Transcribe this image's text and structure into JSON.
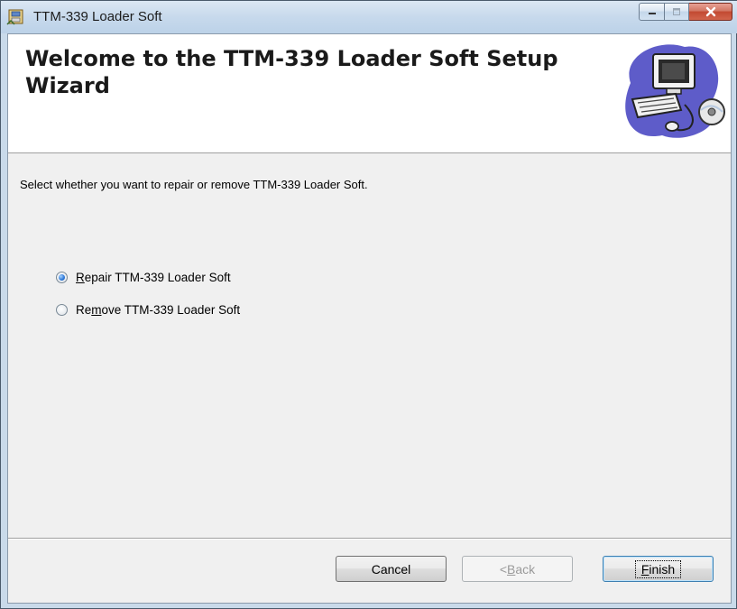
{
  "window": {
    "title": "TTM-339 Loader Soft",
    "icon": "installer-icon",
    "caption_buttons": [
      "minimize-icon",
      "maximize-icon",
      "close-icon"
    ]
  },
  "banner": {
    "title": "Welcome to the TTM-339 Loader Soft Setup Wizard",
    "art": "computer-setup-icon"
  },
  "body": {
    "description": "Select whether you want to repair or remove TTM-339 Loader Soft.",
    "options": [
      {
        "prefix": "",
        "mnemonic": "R",
        "rest": "epair TTM-339 Loader Soft",
        "checked": true
      },
      {
        "prefix": "Re",
        "mnemonic": "m",
        "rest": "ove TTM-339 Loader Soft",
        "checked": false
      }
    ]
  },
  "buttons": {
    "cancel": "Cancel",
    "back_prefix": "< ",
    "back_mnemonic": "B",
    "back_rest": "ack",
    "finish_mnemonic": "F",
    "finish_rest": "inish"
  },
  "colors": {
    "close_button": "#c24a32",
    "radio_selected": "#2a75d6"
  }
}
